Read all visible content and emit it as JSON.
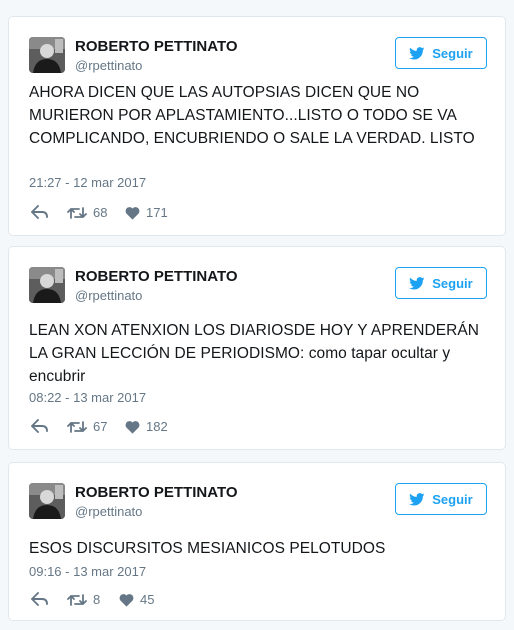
{
  "colors": {
    "brand": "#1da1f2",
    "name": "#14171a",
    "muted": "#657786",
    "border": "#e1e8ed",
    "background": "#f5f8fa"
  },
  "icons": {
    "follow": "twitter-bird-icon",
    "reply": "reply-icon",
    "retweet": "retweet-icon",
    "like": "heart-icon"
  },
  "tweets": [
    {
      "author": {
        "name": "ROBERTO PETTINATO",
        "handle": "@rpettinato"
      },
      "follow_label": "Seguir",
      "text": "AHORA DICEN QUE LAS AUTOPSIAS DICEN QUE NO MURIERON POR APLASTAMIENTO...LISTO O TODO SE VA COMPLICANDO, ENCUBRIENDO O SALE LA VERDAD. LISTO",
      "timestamp": "21:27 - 12 mar 2017",
      "retweets": "68",
      "likes": "171"
    },
    {
      "author": {
        "name": "ROBERTO PETTINATO",
        "handle": "@rpettinato"
      },
      "follow_label": "Seguir",
      "text": "LEAN XON ATENXION LOS DIARIOSDE HOY Y APRENDERÁN LA GRAN LECCIÓN DE PERIODISMO: como tapar ocultar y encubrir",
      "timestamp": "08:22 - 13 mar 2017",
      "retweets": "67",
      "likes": "182"
    },
    {
      "author": {
        "name": "ROBERTO PETTINATO",
        "handle": "@rpettinato"
      },
      "follow_label": "Seguir",
      "text": "ESOS DISCURSITOS MESIANICOS PELOTUDOS",
      "timestamp": "09:16 - 13 mar 2017",
      "retweets": "8",
      "likes": "45"
    }
  ]
}
